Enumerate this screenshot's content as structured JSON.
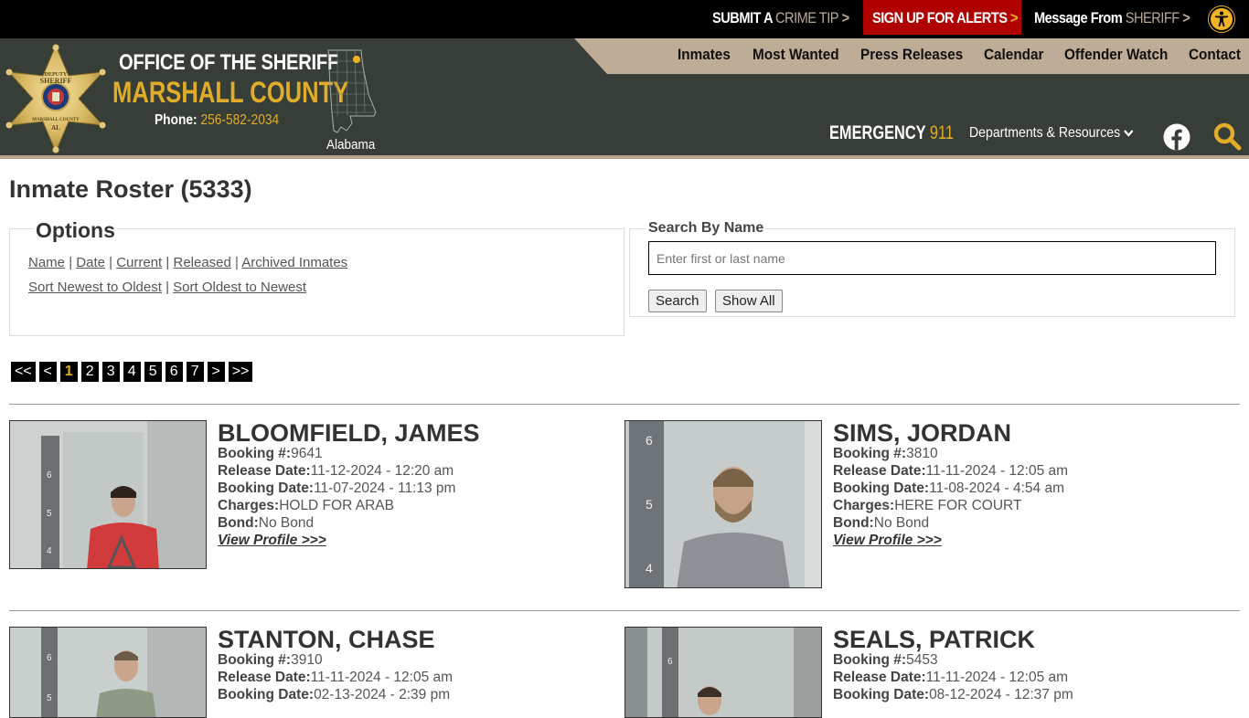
{
  "topbar": {
    "crime_tip_a": "SUBMIT A",
    "crime_tip_b": "CRIME TIP",
    "alerts": "SIGN UP FOR ALERTS",
    "message_a": "Message From",
    "message_b": "SHERIFF",
    "chevron": ">",
    "accessibility_icon": "accessibility-icon"
  },
  "header": {
    "office": "OFFICE OF THE SHERIFF",
    "county": "MARSHALL COUNTY",
    "phone_label": "Phone:",
    "phone": "256-582-2034",
    "state": "Alabama",
    "badge_text": [
      "DEPUTY",
      "SHERIFF",
      "MARSHALL COUNTY",
      "AL"
    ],
    "nav": [
      "Inmates",
      "Most Wanted",
      "Press Releases",
      "Calendar",
      "Offender Watch",
      "Contact"
    ],
    "emergency_label": "EMERGENCY",
    "emergency_num": "911",
    "departments": "Departments & Resources",
    "colors": {
      "gold": "#e0ac2a",
      "header_bg": "#373e37",
      "nav_bg": "#bfac96",
      "alert_red": "#b00000"
    }
  },
  "page": {
    "title": "Inmate Roster (5333)",
    "options": {
      "legend": "Options",
      "filters": [
        "Name",
        "Date",
        "Current",
        "Released",
        "Archived Inmates"
      ],
      "sorts": [
        "Sort Newest to Oldest",
        "Sort Oldest to Newest"
      ],
      "separator": "|"
    },
    "search": {
      "legend": "Search By Name",
      "placeholder": "Enter first or last name",
      "value": "",
      "search_btn": "Search",
      "show_all_btn": "Show All"
    },
    "pager": {
      "first": "<<",
      "prev": "<",
      "next": ">",
      "last": ">>",
      "pages": [
        "1",
        "2",
        "3",
        "4",
        "5",
        "6",
        "7"
      ],
      "current": "1"
    }
  },
  "labels": {
    "booking": "Booking #:",
    "release": "Release Date:",
    "booking_date": "Booking Date:",
    "charges": "Charges:",
    "bond": "Bond:",
    "view_profile": "View Profile >>>"
  },
  "inmates": [
    {
      "name": "BLOOMFIELD, JAMES",
      "booking": "9641",
      "release": "11-12-2024 - 12:20 am",
      "booking_date": "11-07-2024 - 11:13 pm",
      "charges": "HOLD FOR ARAB",
      "bond": "No Bond",
      "shirt": "#d63a3a"
    },
    {
      "name": "SIMS, JORDAN",
      "booking": "3810",
      "release": "11-11-2024 - 12:05 am",
      "booking_date": "11-08-2024 - 4:54 am",
      "charges": "HERE FOR COURT",
      "bond": "No Bond",
      "shirt": "#8c9094"
    },
    {
      "name": "STANTON, CHASE",
      "booking": "3910",
      "release": "11-11-2024 - 12:05 am",
      "booking_date": "02-13-2024 - 2:39 pm"
    },
    {
      "name": "SEALS, PATRICK",
      "booking": "5453",
      "release": "11-11-2024 - 12:05 am",
      "booking_date": "08-12-2024 - 12:37 pm"
    }
  ]
}
